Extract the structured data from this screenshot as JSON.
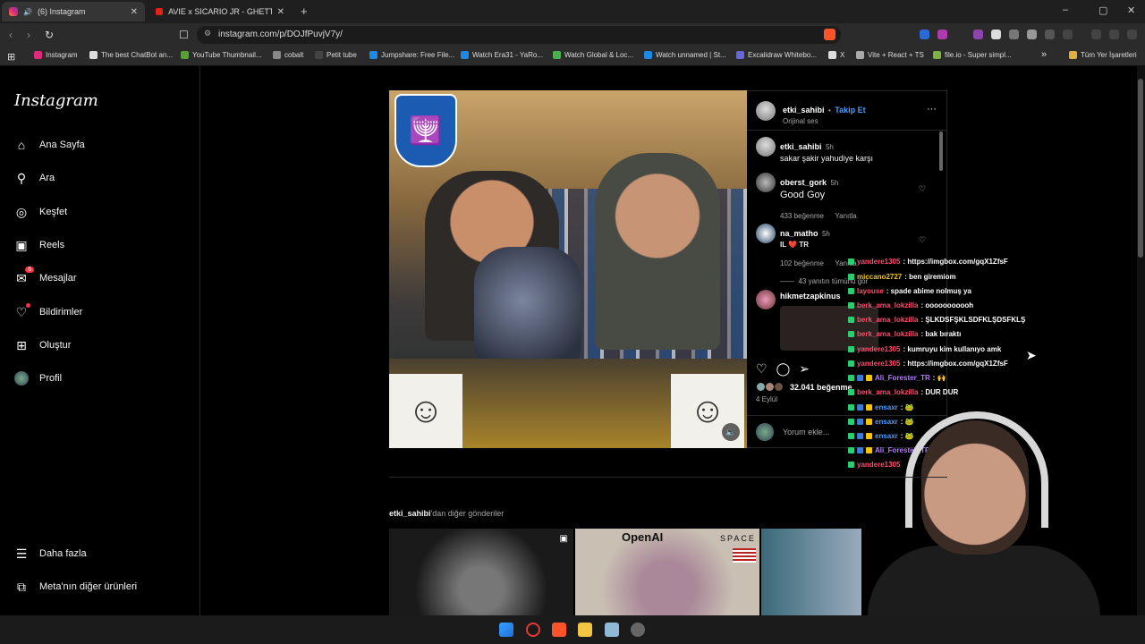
{
  "browser": {
    "tabs": [
      {
        "title": "(6) Instagram",
        "active": true
      },
      {
        "title": "AVIE x SICARIO JR - GHETTODRAMA",
        "active": false
      }
    ],
    "new_tab": "+",
    "window_controls": [
      "–",
      "▢",
      "✕"
    ],
    "url": "instagram.com/p/DOJfPuvjV7y/",
    "bookmarks": [
      {
        "label": "Instagram",
        "color": "#dd2a7b"
      },
      {
        "label": "The best ChatBot an...",
        "color": "#dddddd"
      },
      {
        "label": "YouTube Thumbnail...",
        "color": "#5a9e3a"
      },
      {
        "label": "cobalt",
        "color": "#888888"
      },
      {
        "label": "Petit tube",
        "color": "#444444"
      },
      {
        "label": "Jumpshare: Free File...",
        "color": "#1e88e5"
      },
      {
        "label": "Watch Era31 - YaRo...",
        "color": "#1e88e5"
      },
      {
        "label": "Watch Global & Loc...",
        "color": "#4caf50"
      },
      {
        "label": "Watch unnamed | St...",
        "color": "#1e88e5"
      },
      {
        "label": "Excalidraw Whitebo...",
        "color": "#6965db"
      },
      {
        "label": "X",
        "color": "#dddddd"
      },
      {
        "label": "Vite + React + TS",
        "color": "#aaaaaa"
      },
      {
        "label": "file.io - Super simpl...",
        "color": "#7cb342"
      }
    ],
    "bookmarks_overflow": "»",
    "all_bookmarks": "Tüm Yer İşaretleri"
  },
  "sidebar": {
    "logo": "Instagram",
    "items": [
      {
        "label": "Ana Sayfa",
        "icon": "⌂",
        "name": "home"
      },
      {
        "label": "Ara",
        "icon": "⚲",
        "name": "search"
      },
      {
        "label": "Keşfet",
        "icon": "◎",
        "name": "explore"
      },
      {
        "label": "Reels",
        "icon": "▣",
        "name": "reels"
      },
      {
        "label": "Mesajlar",
        "icon": "✉",
        "name": "messages",
        "badge": "6"
      },
      {
        "label": "Bildirimler",
        "icon": "♡",
        "name": "notifications"
      },
      {
        "label": "Oluştur",
        "icon": "⊞",
        "name": "create"
      },
      {
        "label": "Profil",
        "icon": "",
        "name": "profile"
      }
    ],
    "more": "Daha fazla",
    "meta": "Meta'nın diğer ürünleri"
  },
  "post": {
    "author": "etki_sahibi",
    "follow": "Takip Et",
    "audio": "Orijinal ses",
    "caption_user": "etki_sahibi",
    "caption_time": "5h",
    "caption": "sakar şakir yahudiye karşı",
    "comments": [
      {
        "user": "oberst_gork",
        "time": "5h",
        "text": "Good Goy",
        "likes": "433 beğenme",
        "reply": "Yanıtla"
      },
      {
        "user": "na_matho",
        "time": "5h",
        "text": "IL ❤️ TR",
        "likes": "102 beğenme",
        "reply": "Yanıtla"
      }
    ],
    "view_replies": "43 yanıtın tümünü gör",
    "next_commenter": "hikmetzapkinus",
    "likes": "32.041 beğenme",
    "date": "4 Eylül",
    "comment_placeholder": "Yorum ekle...",
    "menu": "···"
  },
  "chat": [
    {
      "user": "yandere1305",
      "color": "#ff4d6d",
      "msg": ": https://imgbox.com/gqX1ZfsF"
    },
    {
      "user": "miccano2727",
      "color": "#f0c419",
      "msg": ": ben giremiom"
    },
    {
      "user": "layouse",
      "color": "#ff4d6d",
      "msg": ": spade abime nolmuş ya"
    },
    {
      "user": "berk_ama_lokzilla",
      "color": "#ff4d6d",
      "msg": ": ooooooooooh"
    },
    {
      "user": "berk_ama_lokzilla",
      "color": "#ff4d6d",
      "msg": ": ŞLKDSFŞKLSDFKLŞDSFKLŞ"
    },
    {
      "user": "berk_ama_lokzilla",
      "color": "#ff4d6d",
      "msg": ": bak bıraktı"
    },
    {
      "user": "yandere1305",
      "color": "#ff4d6d",
      "msg": ": kumruyu kim kullanıyo amk"
    },
    {
      "user": "yandere1305",
      "color": "#ff4d6d",
      "msg": ": https://imgbox.com/gqX1ZfsF"
    },
    {
      "user": "Ali_Forester_TR",
      "color": "#b57cff",
      "msg": ": 🙌"
    },
    {
      "user": "berk_ama_lokzilla",
      "color": "#ff4d6d",
      "msg": ": DUR DUR"
    },
    {
      "user": "ensaxr",
      "color": "#4a9cff",
      "msg": ": 🐸"
    },
    {
      "user": "ensaxr",
      "color": "#4a9cff",
      "msg": ": 🐸"
    },
    {
      "user": "ensaxr",
      "color": "#4a9cff",
      "msg": ": 🐸"
    },
    {
      "user": "Ali_Forester_TR",
      "color": "#b57cff",
      "msg": ""
    },
    {
      "user": "yandere1305",
      "color": "#ff4d6d",
      "msg": ""
    }
  ],
  "more_posts": {
    "user": "etki_sahibi",
    "suffix": "'dan diğer gönderiler",
    "thumb2_text": "OpenAI",
    "thumb2_sub": "SPACE"
  }
}
